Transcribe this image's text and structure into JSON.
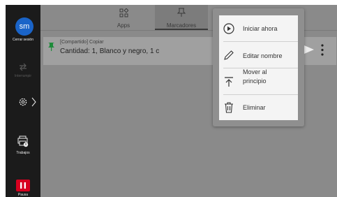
{
  "sidebar": {
    "avatar_initials": "sm",
    "logout_label": "Cerrar sesión",
    "interrupt_label": "Interrumpir",
    "jobs_label": "Trabajos",
    "pause_label": "Pausa",
    "icons": [
      "settings-icon",
      "chevron-right-icon",
      "interrupt-icon",
      "jobs-icon",
      "pause-icon"
    ]
  },
  "tabs": [
    {
      "label": "Apps",
      "icon": "apps-icon",
      "selected": false
    },
    {
      "label": "Marcadores",
      "icon": "pin-icon",
      "selected": true
    }
  ],
  "bookmark": {
    "title": "[Compartido] Copiar",
    "details": "Cantidad: 1, Blanco y negro, 1 c",
    "icon": "pin-icon"
  },
  "menu": {
    "items": [
      {
        "label": "Iniciar ahora",
        "icon": "play-circle-icon"
      },
      {
        "label": "Editar nombre",
        "icon": "pencil-icon"
      },
      {
        "label_line1": "Mover al",
        "label_line2": "principio",
        "icon": "move-to-top-icon"
      },
      {
        "label": "Eliminar",
        "icon": "trash-icon"
      }
    ]
  },
  "colors": {
    "avatar": "#1a64c8",
    "pause": "#d7001f",
    "pin": "#1e8b3a",
    "sidebar": "#1b1b1b"
  }
}
